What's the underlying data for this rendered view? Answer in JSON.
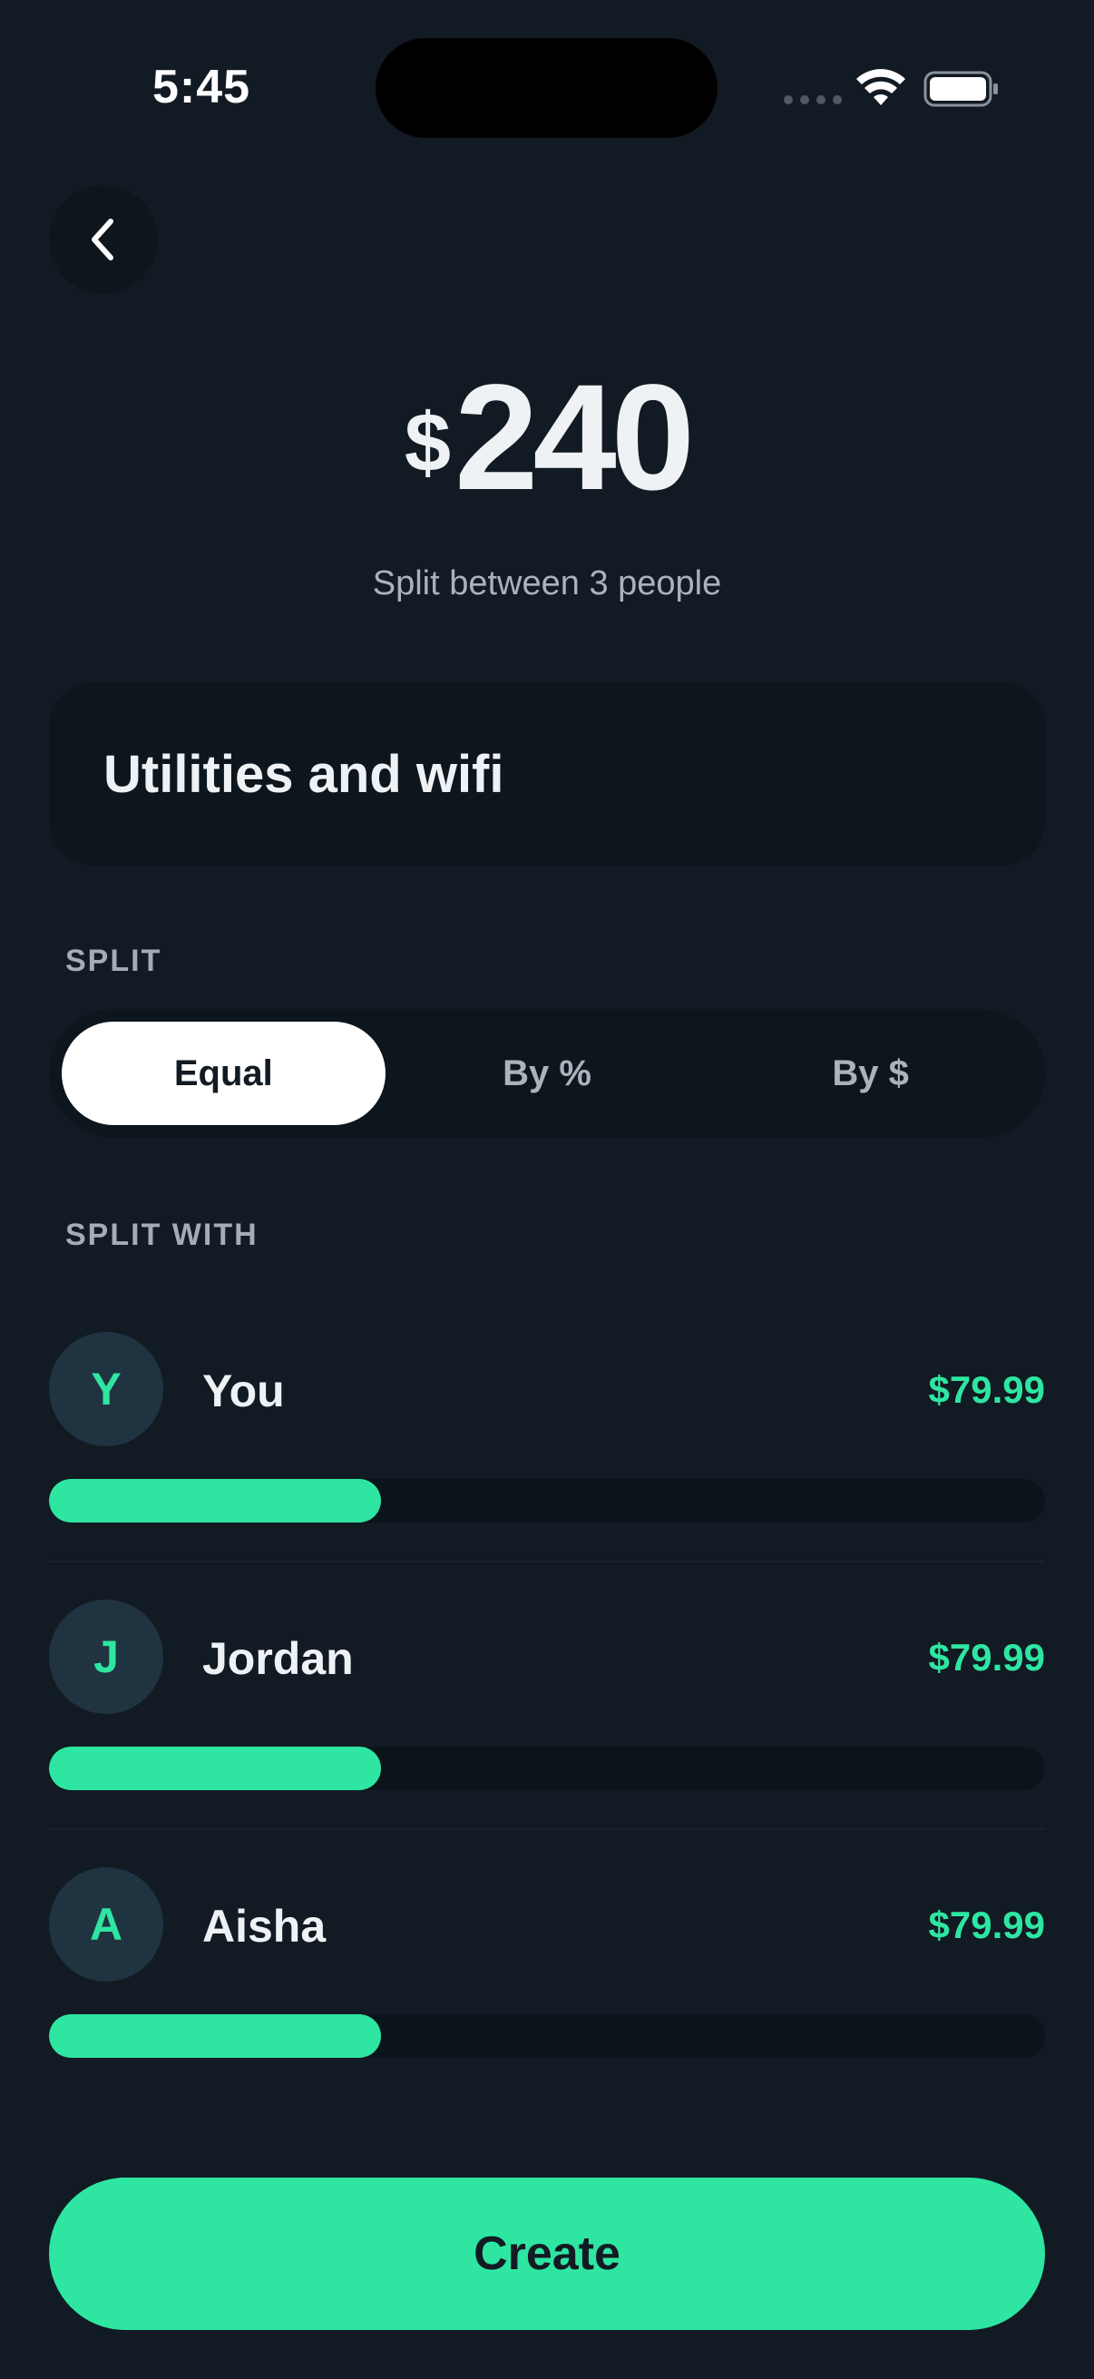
{
  "status_bar": {
    "time": "5:45"
  },
  "icons": {
    "back": "chevron-left-icon",
    "wifi": "wifi-icon",
    "battery": "battery-icon",
    "signal": "cellular-signal-icon"
  },
  "amount": {
    "currency": "$",
    "value": "240"
  },
  "subtitle": "Split between 3 people",
  "description": "Utilities and wifi",
  "split_label": "SPLIT",
  "split_options": [
    {
      "label": "Equal",
      "active": true
    },
    {
      "label": "By %",
      "active": false
    },
    {
      "label": "By $",
      "active": false
    }
  ],
  "split_with_label": "SPLIT WITH",
  "participants": [
    {
      "initial": "Y",
      "name": "You",
      "amount": "$79.99",
      "share": 0.3333
    },
    {
      "initial": "J",
      "name": "Jordan",
      "amount": "$79.99",
      "share": 0.3333
    },
    {
      "initial": "A",
      "name": "Aisha",
      "amount": "$79.99",
      "share": 0.3333
    }
  ],
  "create_label": "Create",
  "colors": {
    "background": "#121a23",
    "accent": "#2ee6a1",
    "card": "#0d151d"
  }
}
